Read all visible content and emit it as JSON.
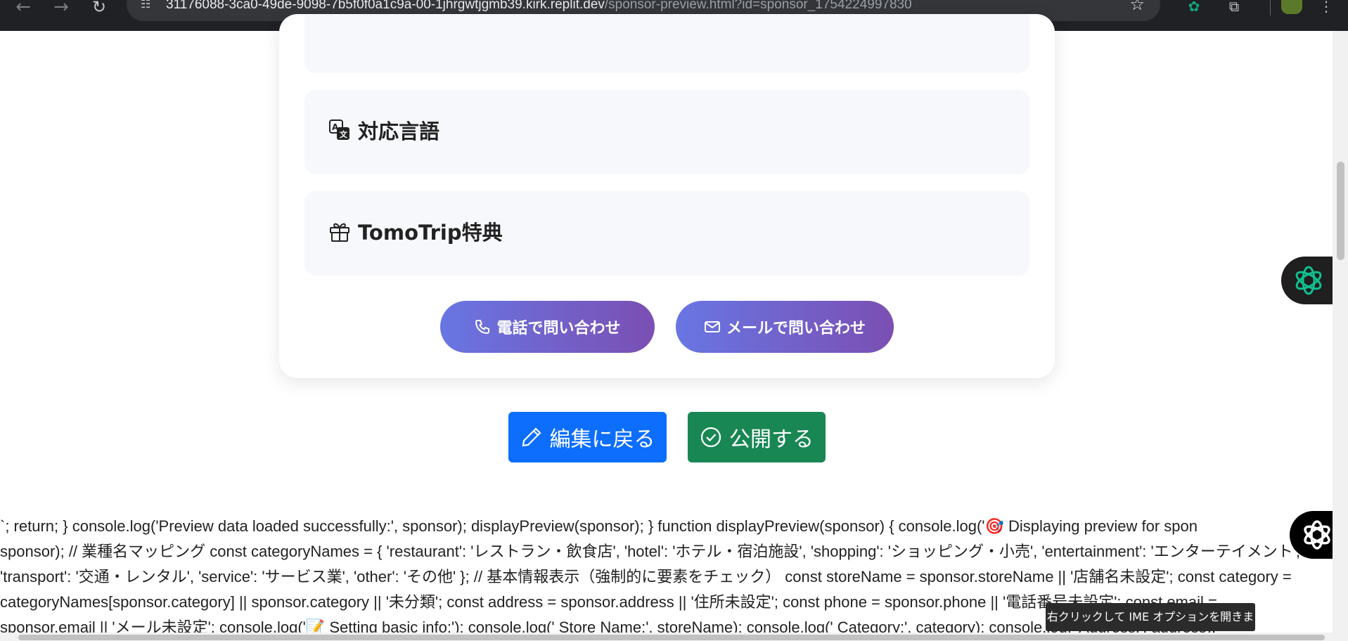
{
  "browser": {
    "url_host": "31176088-3ca0-49de-9098-7b5f0f0a1c9a-00-1jhrgwtjgmb39.kirk.replit.dev",
    "url_path": "/sponsor-preview.html?id=sponsor_1754224997830",
    "icons": [
      "back-arrow-icon",
      "forward-arrow-icon",
      "reload-icon",
      "site-settings-icon",
      "bookmark-star-icon",
      "chatgpt-extension-icon",
      "extensions-puzzle-icon",
      "profile-avatar-icon",
      "kebab-menu-icon"
    ]
  },
  "sections": {
    "languages_title": "対応言語",
    "perks_title": "TomoTrip特典"
  },
  "contact": {
    "phone_label": "電話で問い合わせ",
    "mail_label": "メールで問い合わせ"
  },
  "actions": {
    "edit_label": "編集に戻る",
    "publish_label": "公開する"
  },
  "code_lines": [
    "`; return; } console.log('Preview data loaded successfully:', sponsor); displayPreview(sponsor); } function displayPreview(sponsor) { console.log('🎯 Displaying preview for spon",
    "sponsor); // 業種名マッピング const categoryNames = { 'restaurant': 'レストラン・飲食店', 'hotel': 'ホテル・宿泊施設', 'shopping': 'ショッピング・小売', 'entertainment': 'エンターテイメント',",
    "'transport': '交通・レンタル', 'service': 'サービス業', 'other': 'その他' }; // 基本情報表示（強制的に要素をチェック） const storeName = sponsor.storeName || '店舗名未設定'; const category =",
    "categoryNames[sponsor.category] || sponsor.category || '未分類'; const address = sponsor.address || '住所未設定'; const phone = sponsor.phone || '電話番号未設定'; const email =",
    "sponsor.email || 'メール未設定'; console.log('📝 Setting basic info:'); console.log('  Store Name:', storeName); console.log('  Category:', category); console.log('  Address:', address);"
  ],
  "ime_tooltip": "右クリックして IME オプションを開きます"
}
